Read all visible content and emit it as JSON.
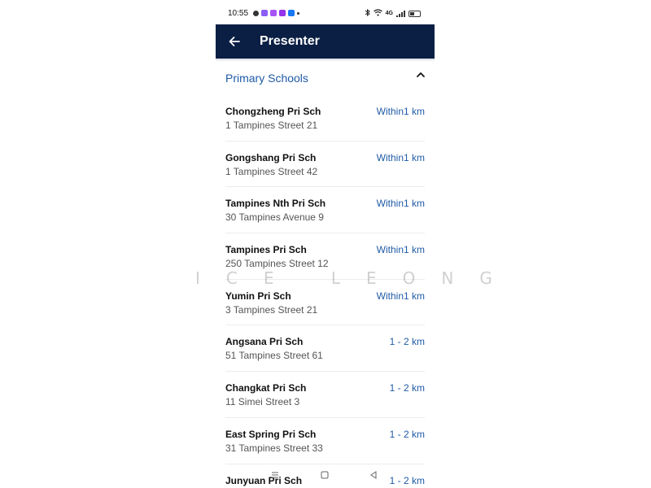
{
  "status_bar": {
    "time": "10:55",
    "network_label": "4G",
    "battery_level": 0.45
  },
  "app_bar": {
    "title": "Presenter",
    "back_icon": "arrow-left-icon"
  },
  "section": {
    "title": "Primary Schools",
    "toggle_icon": "chevron-up-icon"
  },
  "schools": [
    {
      "name": "Chongzheng Pri Sch",
      "address": "1 Tampines Street 21",
      "distance": "Within1 km"
    },
    {
      "name": "Gongshang Pri Sch",
      "address": "1 Tampines Street 42",
      "distance": "Within1 km"
    },
    {
      "name": "Tampines Nth Pri Sch",
      "address": "30 Tampines Avenue 9",
      "distance": "Within1 km"
    },
    {
      "name": "Tampines Pri Sch",
      "address": "250 Tampines Street 12",
      "distance": "Within1 km"
    },
    {
      "name": "Yumin Pri Sch",
      "address": "3 Tampines Street 21",
      "distance": "Within1 km"
    },
    {
      "name": "Angsana Pri Sch",
      "address": "51 Tampines Street 61",
      "distance": "1 - 2 km"
    },
    {
      "name": "Changkat Pri Sch",
      "address": "11 Simei Street 3",
      "distance": "1 - 2 km"
    },
    {
      "name": "East Spring Pri Sch",
      "address": "31 Tampines Street 33",
      "distance": "1 - 2 km"
    },
    {
      "name": "Junyuan Pri Sch",
      "address": "",
      "distance": "1 - 2 km"
    }
  ],
  "nav_bar": {
    "menu_icon": "menu-icon",
    "home_icon": "square-home-icon",
    "back_icon": "triangle-back-icon"
  },
  "watermark": "ICE LEONG",
  "colors": {
    "app_bar": "#0b1f45",
    "accent": "#1f5aa6"
  }
}
